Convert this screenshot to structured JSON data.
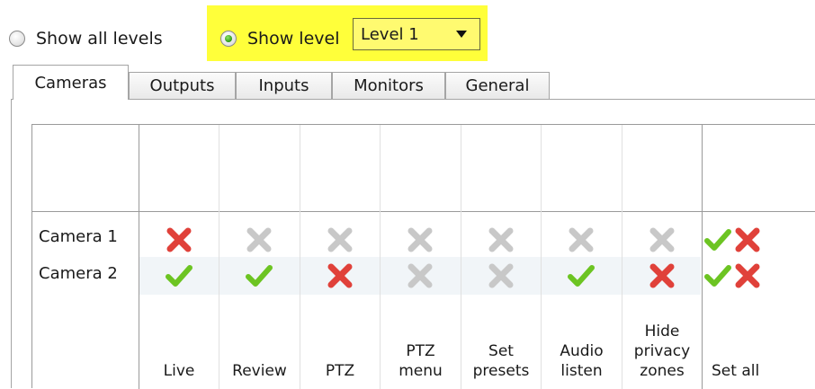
{
  "level_filter": {
    "show_all_label": "Show all levels",
    "show_level_label": "Show level",
    "selected_level": "Level 1",
    "highlight_color": "#ffff3a"
  },
  "tabs": [
    "Cameras",
    "Outputs",
    "Inputs",
    "Monitors",
    "General"
  ],
  "active_tab": "Cameras",
  "table": {
    "columns": [
      {
        "line1": "",
        "line2": "",
        "line3": "Live"
      },
      {
        "line1": "",
        "line2": "",
        "line3": "Review"
      },
      {
        "line1": "",
        "line2": "",
        "line3": "PTZ"
      },
      {
        "line1": "",
        "line2": "PTZ",
        "line3": "menu"
      },
      {
        "line1": "",
        "line2": "Set",
        "line3": "presets"
      },
      {
        "line1": "",
        "line2": "Audio",
        "line3": "listen"
      },
      {
        "line1": "Hide",
        "line2": "privacy",
        "line3": "zones"
      }
    ],
    "set_all_label": "Set all",
    "rows": [
      {
        "label": "Camera 1",
        "cells": [
          "deny",
          "disabled",
          "disabled",
          "disabled",
          "disabled",
          "disabled",
          "disabled"
        ]
      },
      {
        "label": "Camera 2",
        "cells": [
          "allow",
          "allow",
          "deny",
          "disabled",
          "disabled",
          "allow",
          "deny"
        ]
      }
    ],
    "colors": {
      "allow": "#6cc422",
      "deny": "#e0413a",
      "disabled": "#c8c8c8"
    }
  }
}
